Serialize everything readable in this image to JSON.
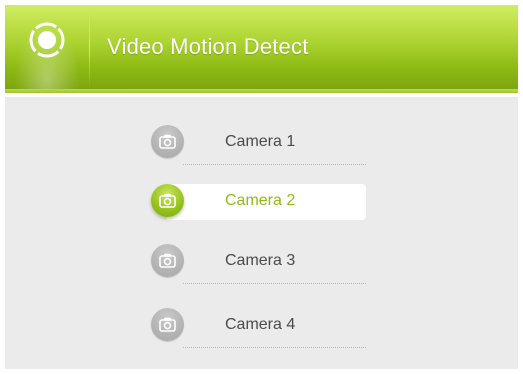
{
  "header": {
    "title": "Video Motion Detect",
    "logo_icon": "target-circle-icon",
    "accent_color": "#8fbb16"
  },
  "camera_list": {
    "selected_index": 1,
    "items": [
      {
        "label": "Camera 1",
        "icon": "camera-icon"
      },
      {
        "label": "Camera 2",
        "icon": "camera-icon"
      },
      {
        "label": "Camera 3",
        "icon": "camera-icon"
      },
      {
        "label": "Camera 4",
        "icon": "camera-icon"
      }
    ]
  }
}
